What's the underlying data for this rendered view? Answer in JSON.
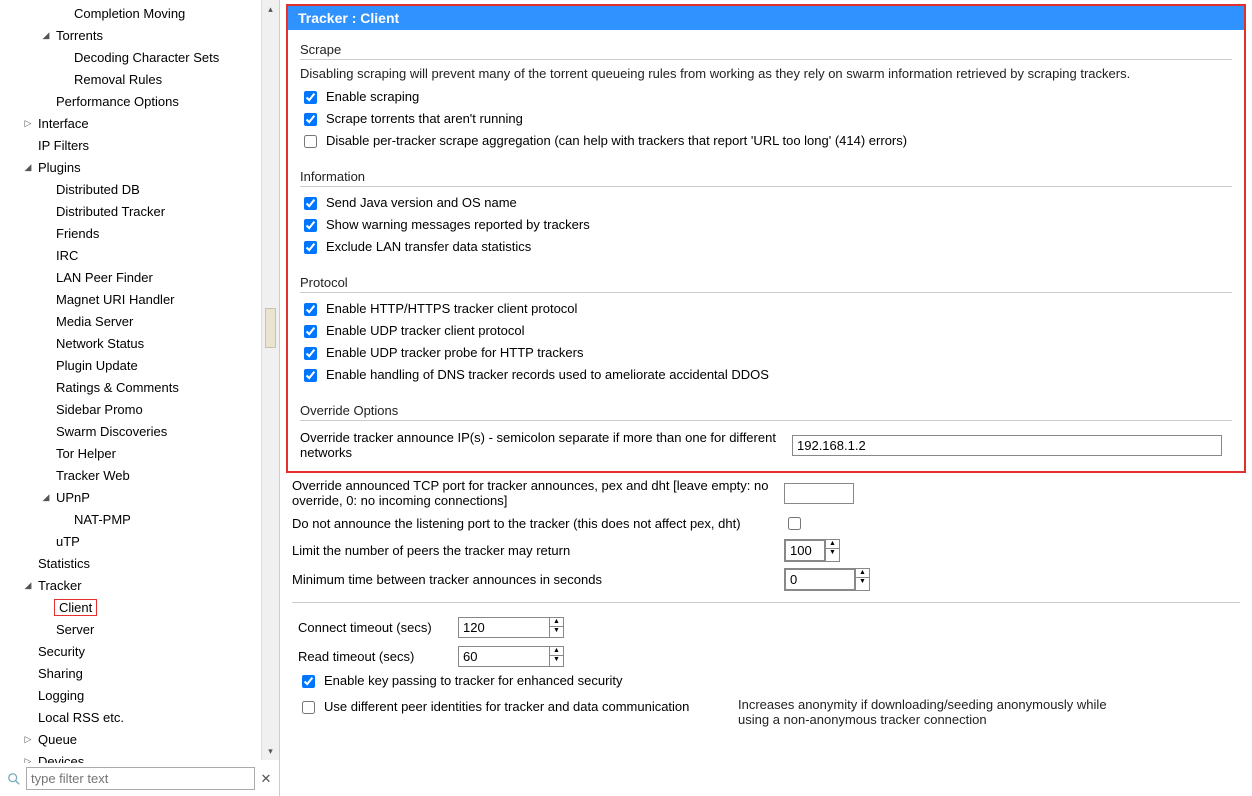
{
  "tree": {
    "completion_moving": "Completion Moving",
    "torrents": "Torrents",
    "decoding": "Decoding Character Sets",
    "removal": "Removal Rules",
    "perf": "Performance Options",
    "interface": "Interface",
    "ipfilters": "IP Filters",
    "plugins": "Plugins",
    "ddb": "Distributed DB",
    "dtracker": "Distributed Tracker",
    "friends": "Friends",
    "irc": "IRC",
    "lan": "LAN Peer Finder",
    "magnet": "Magnet URI Handler",
    "media": "Media Server",
    "netstat": "Network Status",
    "pluginupd": "Plugin Update",
    "ratings": "Ratings & Comments",
    "sidebar": "Sidebar Promo",
    "swarm": "Swarm Discoveries",
    "tor": "Tor Helper",
    "tweb": "Tracker Web",
    "upnp": "UPnP",
    "natpmp": "NAT-PMP",
    "utp": "uTP",
    "statistics": "Statistics",
    "tracker": "Tracker",
    "client": "Client",
    "server": "Server",
    "security": "Security",
    "sharing": "Sharing",
    "logging": "Logging",
    "rss": "Local RSS etc.",
    "queue": "Queue",
    "devices": "Devices"
  },
  "filter_placeholder": "type filter text",
  "header": "Tracker : Client",
  "scrape": {
    "title": "Scrape",
    "desc": "Disabling scraping will prevent many of the torrent queueing rules from working as they rely on swarm information retrieved by scraping trackers.",
    "c1": "Enable scraping",
    "c2": "Scrape torrents that aren't running",
    "c3": "Disable per-tracker scrape aggregation (can help with trackers that report 'URL too long' (414) errors)"
  },
  "info": {
    "title": "Information",
    "c1": "Send Java version and OS name",
    "c2": "Show warning messages reported by trackers",
    "c3": "Exclude LAN transfer data statistics"
  },
  "proto": {
    "title": "Protocol",
    "c1": "Enable HTTP/HTTPS tracker client protocol",
    "c2": "Enable UDP tracker client protocol",
    "c3": "Enable UDP tracker probe for HTTP trackers",
    "c4": "Enable handling of DNS tracker records used to ameliorate accidental DDOS"
  },
  "override": {
    "title": "Override Options",
    "ip_label": "Override tracker announce IP(s) - semicolon separate if more than one for different networks",
    "ip_value": "192.168.1.2",
    "port_label": "Override announced TCP port for tracker announces, pex and dht [leave empty: no override, 0: no incoming connections]",
    "port_value": "",
    "noannounce_label": "Do not announce the listening port to the tracker (this does not affect pex, dht)",
    "peerlimit_label": "Limit the number of peers the tracker may return",
    "peerlimit_value": "100",
    "mintime_label": "Minimum time between tracker announces in seconds",
    "mintime_value": "0"
  },
  "lower": {
    "connect_label": "Connect timeout (secs)",
    "connect_value": "120",
    "read_label": "Read timeout (secs)",
    "read_value": "60",
    "keypass": "Enable key passing to tracker for enhanced security",
    "diffident": "Use different peer identities for tracker and data communication",
    "diffident_note": "Increases anonymity if downloading/seeding anonymously while using a non-anonymous tracker connection"
  }
}
